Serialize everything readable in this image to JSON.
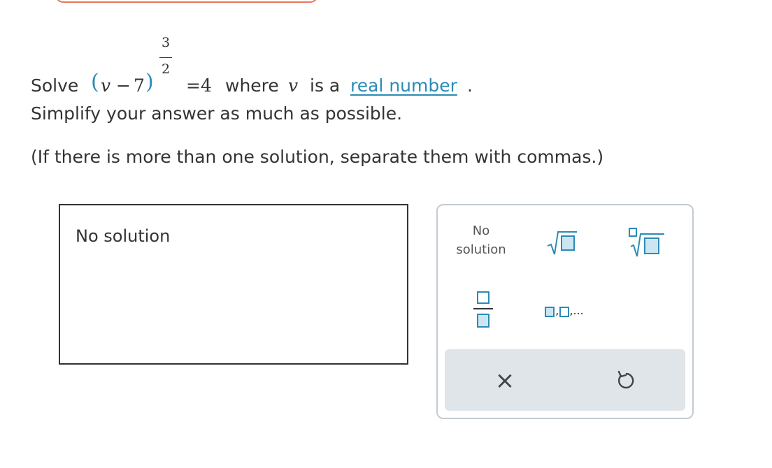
{
  "problem": {
    "solve_word": "Solve",
    "var": "v",
    "minus": "−",
    "seven": "7",
    "exp_num": "3",
    "exp_den": "2",
    "eq": "=4",
    "where_text": "where",
    "var2": "v",
    "is_a": "is a",
    "link": "real number",
    "period": ".",
    "simplify": "Simplify your answer as much as possible.",
    "instructions": "(If there is more than one solution, separate them with commas.)"
  },
  "answer": {
    "value": "No solution"
  },
  "keypad": {
    "no_solution_line1": "No",
    "no_solution_line2": "solution",
    "list_dots": ",...",
    "clear_glyph": "×",
    "undo_glyph": "↺"
  },
  "colors": {
    "accent": "#2b8bb6",
    "accent_fill": "#cce6f1",
    "pill_border": "#e9775a",
    "keypad_border": "#c3cbd2",
    "action_bar": "#dfe5e9",
    "text": "#333333"
  },
  "icons": [
    "square-root-icon",
    "nth-root-icon",
    "fraction-icon",
    "list-icon",
    "clear-icon",
    "undo-icon"
  ]
}
